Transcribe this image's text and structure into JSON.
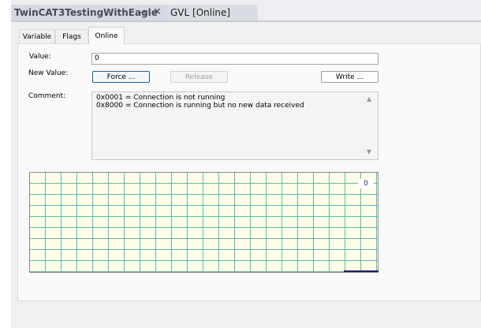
{
  "tabs": {
    "active_doc": "TwinCAT3TestingWithEagle",
    "inactive_doc": "GVL [Online]",
    "pin_glyph": "⊣",
    "close_glyph": "✕"
  },
  "panel_tabs": [
    "Variable",
    "Flags",
    "Online"
  ],
  "fields": {
    "value_label": "Value:",
    "value": "0",
    "new_value_label": "New Value:",
    "comment_label": "Comment:",
    "comment_lines": [
      "0x0001 = Connection is not running",
      "0x8000 = Connection is running but no new data received"
    ]
  },
  "buttons": {
    "force": "Force ...",
    "release": "Release",
    "write": "Write ..."
  },
  "scroll": {
    "up": "▲",
    "down": "▼"
  },
  "chart_data": {
    "type": "line",
    "readout": "0",
    "y_value": 0,
    "background": "#ffffe8",
    "grid_color": "#5bbbb0",
    "line_color": "#1f1d6e"
  }
}
